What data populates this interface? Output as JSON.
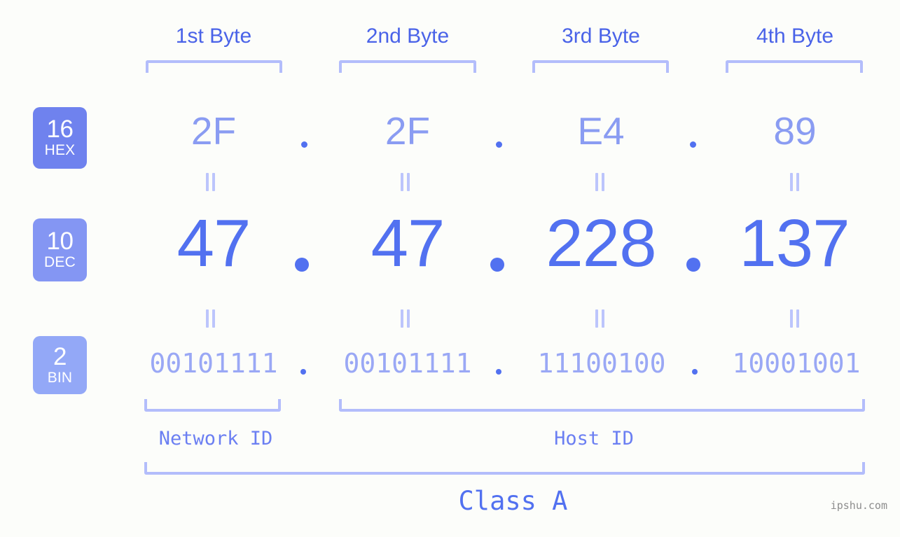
{
  "meta": {
    "watermark": "ipshu.com",
    "background_color": "#fcfdfa"
  },
  "colors": {
    "bracket": "#b3bdfb",
    "header_label": "#4a63e8",
    "hex_text": "#8a9cf2",
    "dec_text": "#5271f0",
    "bin_text": "#9aa8f5",
    "badge_hex_bg": "#6f82ee",
    "badge_dec_bg": "#8496f3",
    "badge_bin_bg": "#93a8f7",
    "equals_mark": "#bcc5fc",
    "watermark_text": "#8d8d8d"
  },
  "byte_headers": [
    {
      "label": "1st Byte"
    },
    {
      "label": "2nd Byte"
    },
    {
      "label": "3rd Byte"
    },
    {
      "label": "4th Byte"
    }
  ],
  "bases": [
    {
      "number": "16",
      "name": "HEX"
    },
    {
      "number": "10",
      "name": "DEC"
    },
    {
      "number": "2",
      "name": "BIN"
    }
  ],
  "separator": ".",
  "rows": {
    "hex": {
      "base_number": "16",
      "base_name": "HEX",
      "octets": [
        "2F",
        "2F",
        "E4",
        "89"
      ],
      "full": "2F.2F.E4.89"
    },
    "dec": {
      "base_number": "10",
      "base_name": "DEC",
      "octets": [
        "47",
        "47",
        "228",
        "137"
      ],
      "full": "47.47.228.137"
    },
    "bin": {
      "base_number": "2",
      "base_name": "BIN",
      "octets": [
        "00101111",
        "00101111",
        "11100100",
        "10001001"
      ],
      "full": "00101111.00101111.11100100.10001001"
    }
  },
  "equality_symbol": "=",
  "sections": {
    "network_id": "Network ID",
    "host_id": "Host ID",
    "class": "Class A"
  }
}
